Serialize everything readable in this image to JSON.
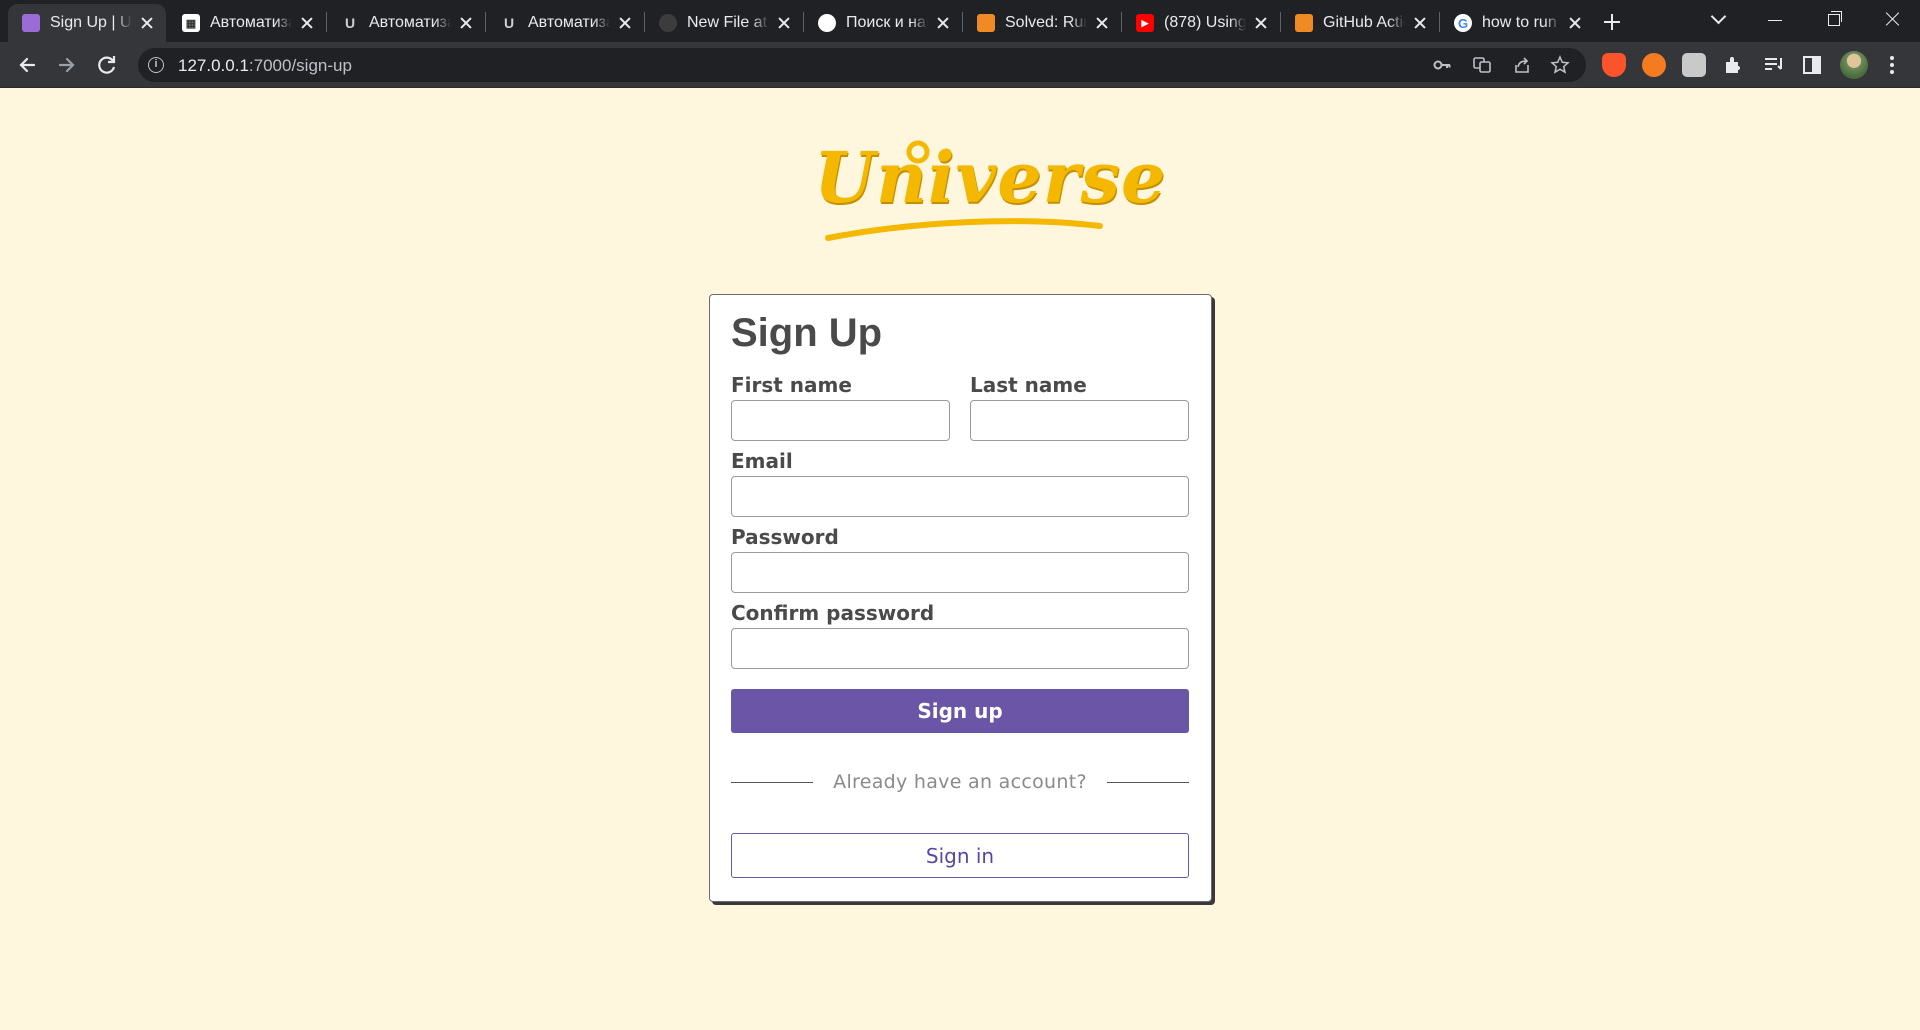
{
  "browser": {
    "tabs": [
      {
        "title": "Sign Up | Universe",
        "favicon_color": "#9b6bd6",
        "active": true
      },
      {
        "title": "Автоматизация",
        "favicon_color": "#ffffff"
      },
      {
        "title": "Автоматизация",
        "favicon_color": "#cfcfcf"
      },
      {
        "title": "Автоматизация",
        "favicon_color": "#cfcfcf"
      },
      {
        "title": "New File at",
        "favicon_color": "#3c3c3c"
      },
      {
        "title": "Поиск и навигация",
        "favicon_color": "#ffffff"
      },
      {
        "title": "Solved: Run",
        "favicon_color": "#f08a24"
      },
      {
        "title": "(878) Using",
        "favicon_color": "#ff0000"
      },
      {
        "title": "GitHub Actions",
        "favicon_color": "#f08a24"
      },
      {
        "title": "how to run",
        "favicon_color": "#4285f4"
      }
    ],
    "url_host": "127.0.0.1",
    "url_path": ":7000/sign-up",
    "colors": {
      "chrome_dark": "#202124",
      "toolbar": "#35363a"
    }
  },
  "page": {
    "logo_text": "Universe",
    "title": "Sign Up",
    "fields": {
      "first_name": {
        "label": "First name",
        "value": ""
      },
      "last_name": {
        "label": "Last name",
        "value": ""
      },
      "email": {
        "label": "Email",
        "value": ""
      },
      "password": {
        "label": "Password",
        "value": ""
      },
      "confirm_password": {
        "label": "Confirm password",
        "value": ""
      }
    },
    "signup_button": "Sign up",
    "divider_text": "Already have an account?",
    "signin_button": "Sign in",
    "colors": {
      "background": "#fff6de",
      "accent": "#6a55a6",
      "logo": "#f5b800"
    }
  }
}
